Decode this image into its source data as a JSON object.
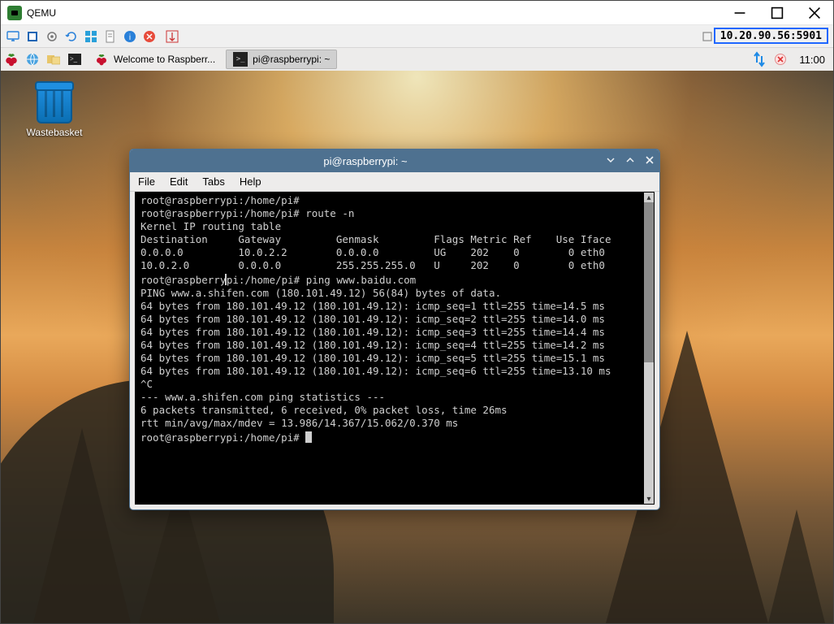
{
  "window": {
    "title": "QEMU"
  },
  "qemu_toolbar": {
    "ip": "10.20.90.56:5901"
  },
  "panel": {
    "tasks": [
      {
        "label": "Welcome to Raspberr...",
        "icon": "raspberry"
      },
      {
        "label": "pi@raspberrypi: ~",
        "icon": "terminal"
      }
    ],
    "clock": "11:00"
  },
  "desktop": {
    "wastebasket": "Wastebasket"
  },
  "terminal": {
    "title": "pi@raspberrypi: ~",
    "menu": {
      "file": "File",
      "edit": "Edit",
      "tabs": "Tabs",
      "help": "Help"
    },
    "lines": [
      "root@raspberrypi:/home/pi#",
      "root@raspberrypi:/home/pi# route -n",
      "Kernel IP routing table",
      "Destination     Gateway         Genmask         Flags Metric Ref    Use Iface",
      "0.0.0.0         10.0.2.2        0.0.0.0         UG    202    0        0 eth0",
      "10.0.2.0        0.0.0.0         255.255.255.0   U     202    0        0 eth0",
      "root@raspberrypi:/home/pi# ping www.baidu.com",
      "PING www.a.shifen.com (180.101.49.12) 56(84) bytes of data.",
      "64 bytes from 180.101.49.12 (180.101.49.12): icmp_seq=1 ttl=255 time=14.5 ms",
      "64 bytes from 180.101.49.12 (180.101.49.12): icmp_seq=2 ttl=255 time=14.0 ms",
      "64 bytes from 180.101.49.12 (180.101.49.12): icmp_seq=3 ttl=255 time=14.4 ms",
      "64 bytes from 180.101.49.12 (180.101.49.12): icmp_seq=4 ttl=255 time=14.2 ms",
      "64 bytes from 180.101.49.12 (180.101.49.12): icmp_seq=5 ttl=255 time=15.1 ms",
      "64 bytes from 180.101.49.12 (180.101.49.12): icmp_seq=6 ttl=255 time=13.10 ms",
      "^C",
      "--- www.a.shifen.com ping statistics ---",
      "6 packets transmitted, 6 received, 0% packet loss, time 26ms",
      "rtt min/avg/max/mdev = 13.986/14.367/15.062/0.370 ms",
      "root@raspberrypi:/home/pi# "
    ],
    "body_cursor_line": 6
  }
}
